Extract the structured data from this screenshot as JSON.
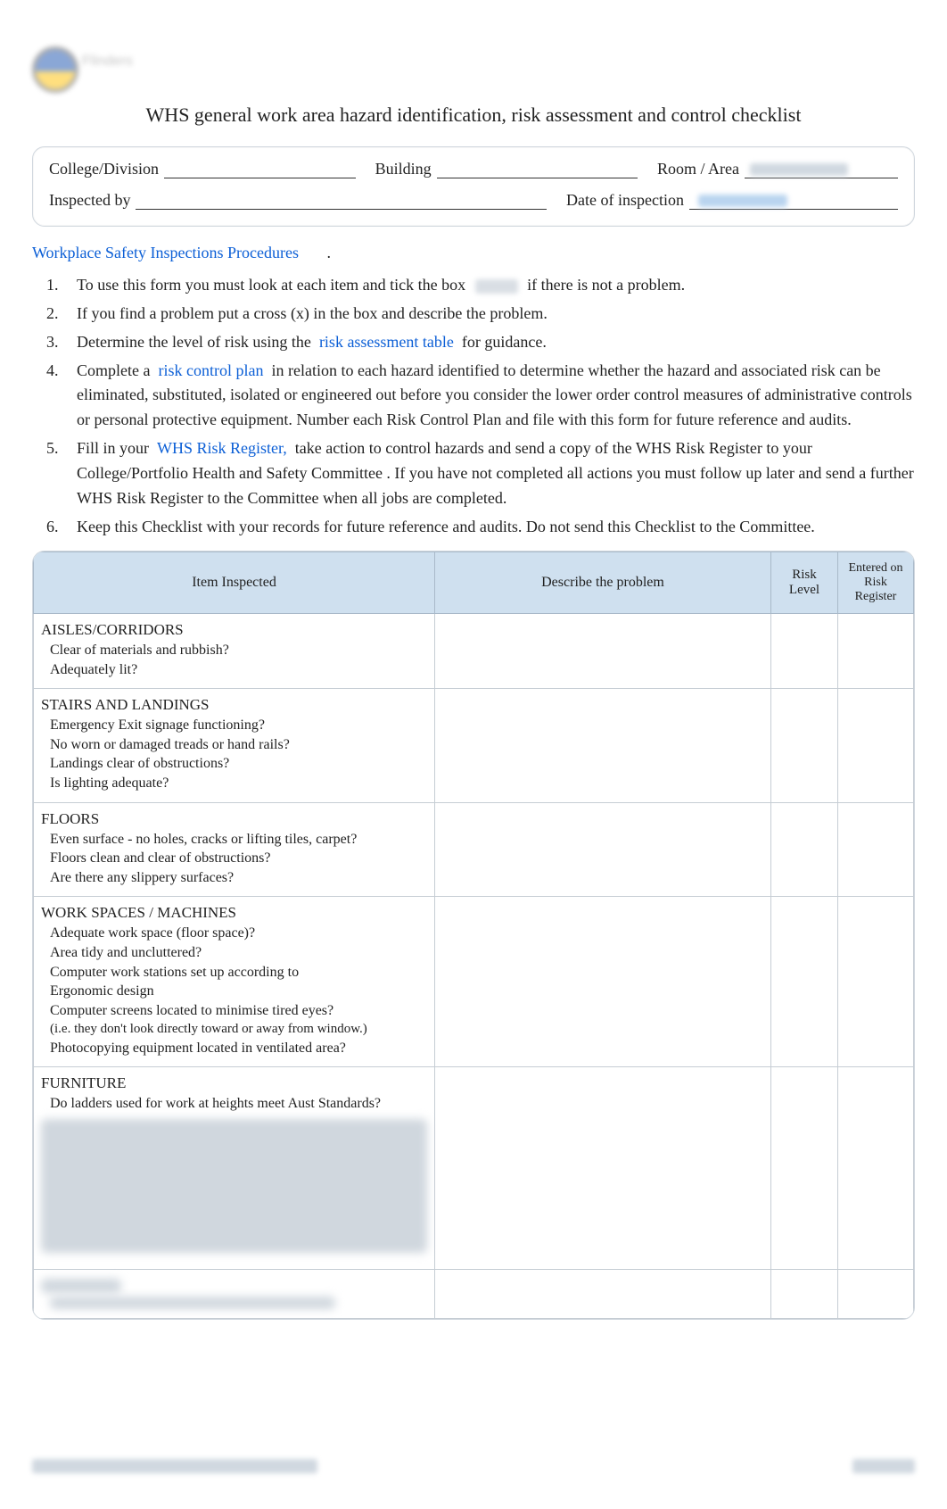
{
  "doc": {
    "title": "WHS general work area hazard identification, risk assessment and control checklist",
    "logo_text": "Flinders"
  },
  "info": {
    "college_division_label": "College/Division",
    "building_label": "Building",
    "room_area_label": "Room / Area",
    "inspected_by_label": "Inspected by",
    "date_of_inspection_label": "Date of inspection"
  },
  "links": {
    "procedures": "Workplace Safety Inspections Procedures",
    "risk_assessment_table": "risk assessment table",
    "risk_control_plan": "risk control plan",
    "whs_risk_register": "WHS Risk Register,"
  },
  "instr": {
    "period": ".",
    "i1_a": "To use this form you must look at each item and tick the box",
    "i1_b": "if there is not a problem.",
    "i2": "If you find a problem put a cross (x) in the box and describe the problem.",
    "i3_a": "Determine the level of risk using the",
    "i3_b": "for guidance.",
    "i4_a": "Complete a",
    "i4_b": "in relation to each hazard identified to determine whether the hazard and associated risk can be eliminated, substituted, isolated or engineered out before you consider the lower order control measures of administrative controls or personal protective equipment.    Number each Risk Control Plan and file with this form for future reference and audits.",
    "i5_a": "Fill in your",
    "i5_b": "take action to control hazards and     send a copy of the WHS Risk Register to your College/Portfolio Health and Safety Committee       .  If you have not completed all actions you must follow up later and send a further WHS Risk Register to the Committee when all jobs are completed.",
    "i6": "Keep this Checklist with your records for future reference and audits.         Do not send this Checklist to the Committee."
  },
  "table": {
    "headers": {
      "item": "Item Inspected",
      "problem": "Describe the problem",
      "risk": "Risk Level",
      "register": "Entered on Risk Register"
    },
    "box_glyph": "",
    "sections": [
      {
        "title": "AISLES/CORRIDORS",
        "items": [
          {
            "text": "Clear of materials and rubbish?"
          },
          {
            "text": "Adequately lit?"
          }
        ]
      },
      {
        "title": "STAIRS AND LANDINGS",
        "items": [
          {
            "text": "Emergency Exit signage functioning?"
          },
          {
            "text": "No worn or damaged treads or hand rails?"
          },
          {
            "text": "Landings clear of obstructions?"
          },
          {
            "text": "Is lighting adequate?"
          }
        ]
      },
      {
        "title": "FLOORS",
        "items": [
          {
            "text": "Even surface - no holes, cracks or lifting tiles, carpet?"
          },
          {
            "text": "Floors clean and clear of obstructions?"
          },
          {
            "text": "Are there any slippery surfaces?"
          }
        ]
      },
      {
        "title": "WORK SPACES / MACHINES",
        "title_box": true,
        "items": [
          {
            "text": "Adequate work space (floor space)?"
          },
          {
            "text": "Area tidy and uncluttered?"
          },
          {
            "text": "Computer   work stations set up according to",
            "nobox": true
          },
          {
            "text": "Ergonomic design"
          },
          {
            "text": "Computer screens located to minimise tired eyes?"
          },
          {
            "text": "(i.e. they don't look directly toward or away from window.)",
            "sub": true,
            "nobox": true
          },
          {
            "text": "Photocopying equipment located in ventilated area?"
          }
        ]
      },
      {
        "title": "FURNITURE",
        "title_box": true,
        "items": [
          {
            "text": "Do ladders used for work at heights meet Aust Standards?",
            "nobox": true
          }
        ],
        "blurred_body": true
      },
      {
        "title": "",
        "blurred_head": true,
        "items": [
          {
            "text": "",
            "blurred": true
          }
        ]
      }
    ]
  }
}
